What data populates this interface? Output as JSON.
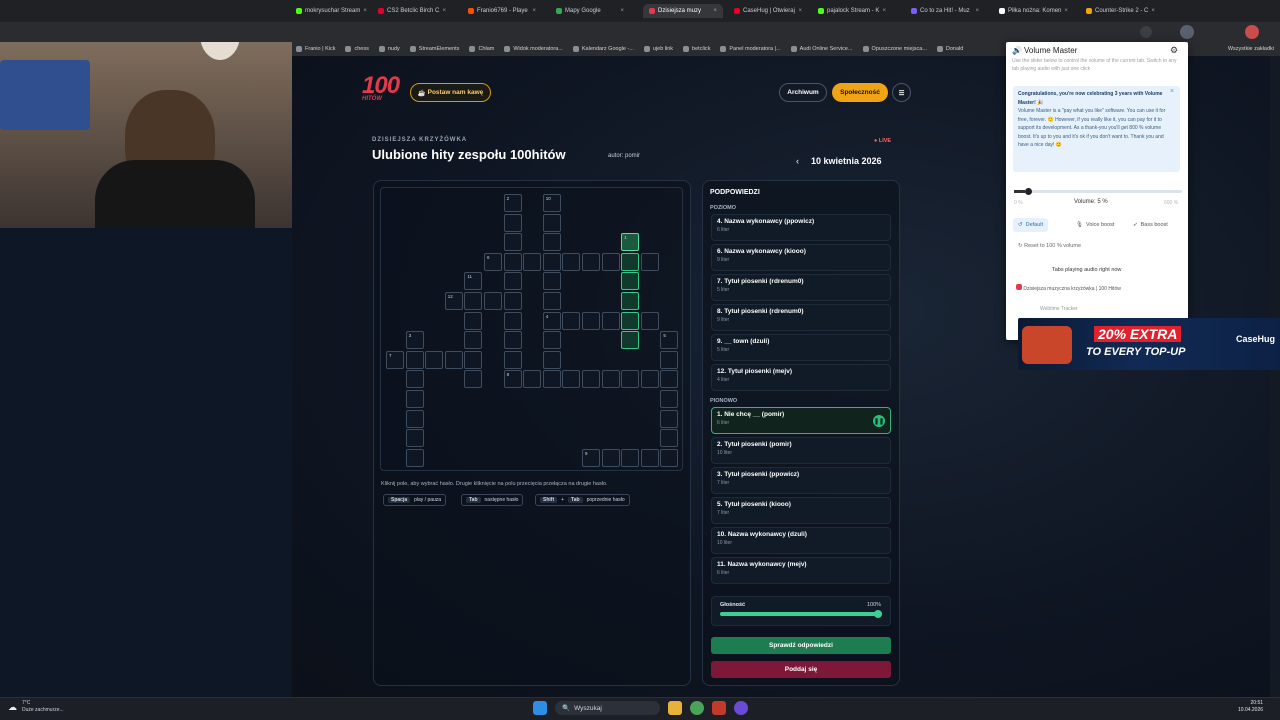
{
  "browser": {
    "tabs": [
      {
        "label": "mokrysuchar Stream",
        "color": "#53fc18"
      },
      {
        "label": "CS2 Betclic Birch C",
        "color": "#e5002b"
      },
      {
        "label": "Franio6769 - Playe",
        "color": "#ff4d00"
      },
      {
        "label": "Mapy Google",
        "color": "#34a853"
      },
      {
        "label": "Dzisiejsza muzy",
        "color": "#e23a4a",
        "active": true
      },
      {
        "label": "CaseHug | Otwieraj",
        "color": "#e5002b"
      },
      {
        "label": "pajalock Stream - K",
        "color": "#53fc18"
      },
      {
        "label": "Co to za Hit! - Muz",
        "color": "#7a5cff"
      },
      {
        "label": "Piłka nożna: Komen",
        "color": "#ffffff"
      },
      {
        "label": "Counter-Strike 2 - C",
        "color": "#f0a415"
      }
    ],
    "bookmarks": [
      "Franio | Kick",
      "chess",
      "nudy",
      "StreamElements",
      "Chłam",
      "Widok moderatora...",
      "Kalendarz Google -...",
      "ujeb link",
      "betclick",
      "Panel moderatora |...",
      "Audi Online Service...",
      "Opuszczone miejsca...",
      "Donald"
    ],
    "bookmarks_all": "Wszystkie zakładki"
  },
  "site": {
    "logo_text": "100",
    "logo_sub": "HITÓW",
    "coffee_button": "Postaw nam kawę",
    "archive_button": "Archiwum",
    "community_button": "Społeczność",
    "menu_icon": "☰"
  },
  "puzzle": {
    "kicker": "DZISIEJSZA KRZYŻÓWKA",
    "title": "Ulubione hity zespołu 100hitów",
    "author": "autor: pomir",
    "live_badge": "LIVE",
    "date": "10 kwietnia 2026",
    "hint": "Kliknij pole, aby wybrać hasło. Drugie kliknięcie na polu przecięcia przełącza na drugie hasło.",
    "shortcuts": [
      {
        "keys": [
          "Spacja"
        ],
        "label": "play / pauza"
      },
      {
        "keys": [
          "Tab"
        ],
        "label": "następne hasło"
      },
      {
        "keys": [
          "Shift",
          "Tab"
        ],
        "label": "poprzednie hasło",
        "joiner": "+"
      }
    ]
  },
  "clues": {
    "title": "PODPOWIEDZI",
    "across_title": "POZIOMO",
    "down_title": "PIONOWO",
    "across": [
      {
        "text": "4. Nazwa wykonawcy (ppowicz)",
        "len": "6 liter"
      },
      {
        "text": "6. Nazwa wykonawcy (kiooo)",
        "len": "9 liter"
      },
      {
        "text": "7. Tytuł piosenki (rdrenum0)",
        "len": "5 liter"
      },
      {
        "text": "8. Tytuł piosenki (rdrenum0)",
        "len": "9 liter"
      },
      {
        "text": "9. __ town (dzuli)",
        "len": "5 liter"
      },
      {
        "text": "12. Tytuł piosenki (mejv)",
        "len": "4 liter"
      }
    ],
    "down": [
      {
        "text": "1. Nie chcę __ (pomir)",
        "len": "6 liter",
        "active": true
      },
      {
        "text": "2. Tytuł piosenki (pomir)",
        "len": "10 liter"
      },
      {
        "text": "3. Tytuł piosenki (ppowicz)",
        "len": "7 liter"
      },
      {
        "text": "5. Tytuł piosenki (kiooo)",
        "len": "7 liter"
      },
      {
        "text": "10. Nazwa wykonawcy (dzuli)",
        "len": "10 liter"
      },
      {
        "text": "11. Nazwa wykonawcy (mejv)",
        "len": "6 liter"
      }
    ],
    "pause_icon": "❚❚",
    "volume_label": "Głośność",
    "volume_value": "100%",
    "volume_fraction": 1.0,
    "check_button": "Sprawdź odpowiedzi",
    "giveup_button": "Poddaj się"
  },
  "volume_master": {
    "title": "Volume Master",
    "description": "Use the slider below to control the volume of the current tab. Switch to any tab playing audio with just one click",
    "congrats_bold": "Congratulations, you're now celebrating 3 years with Volume Master! 🎉",
    "congrats_body": "Volume Master is a \"pay what you like\" software. You can use it for free, forever. 🙂 However, if you really like it, you can pay for it to support its development. As a thank-you you'll get 800 % volume boost. It's up to you and it's ok if you don't want to. Thank you and have a nice day! 😊",
    "min_label": "0 %",
    "max_label": "600 %",
    "volume_text": "Volume: 5 %",
    "volume_fraction": 0.0083,
    "modes": [
      "Default",
      "Voice boost",
      "Bass boost"
    ],
    "reset": "Reset to 100 % volume",
    "tabs_heading": "Tabs playing audio right now",
    "tab_item": "Dzisiejsza muzyczna krzyżówka | 100 Hitów",
    "webtime": "Webtime Tracker"
  },
  "ad": {
    "line1": "20% EXTRA",
    "line2": "TO EVERY TOP-UP",
    "brand": "CaseHug"
  },
  "taskbar": {
    "weather_temp": "7°C",
    "weather_desc": "Duże zachmurze...",
    "search_placeholder": "Wyszukaj",
    "time": "20:51",
    "date": "10.04.2026"
  }
}
